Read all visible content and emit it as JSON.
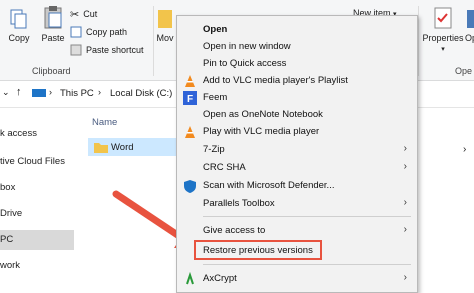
{
  "ribbon": {
    "copy": "Copy",
    "paste": "Paste",
    "cut": "Cut",
    "copy_path": "Copy path",
    "paste_shortcut": "Paste shortcut",
    "move_to": "Mov",
    "new_item": "New item",
    "properties": "Properties",
    "open_truncated": "Ope",
    "clipboard_group": "Clipboard",
    "open_group_truncated": "Ope"
  },
  "address": {
    "this_pc": "This PC",
    "local_disk": "Local Disk (C:)"
  },
  "nav": {
    "items": [
      "k access",
      "tive Cloud Files",
      "box",
      "Drive",
      "PC",
      "work"
    ]
  },
  "content": {
    "name_header": "Name",
    "folder_name": "Word"
  },
  "context_menu": {
    "items": [
      {
        "label": "Open",
        "bold": true
      },
      {
        "label": "Open in new window"
      },
      {
        "label": "Pin to Quick access"
      },
      {
        "label": "Add to VLC media player's Playlist",
        "icon": "vlc-cone-icon"
      },
      {
        "label": "Feem",
        "icon": "feem-icon"
      },
      {
        "label": "Open as OneNote Notebook"
      },
      {
        "label": "Play with VLC media player",
        "icon": "vlc-cone-icon"
      },
      {
        "label": "7-Zip",
        "submenu": true
      },
      {
        "label": "CRC SHA",
        "submenu": true
      },
      {
        "label": "Scan with Microsoft Defender...",
        "icon": "defender-shield-icon"
      },
      {
        "label": "Parallels Toolbox",
        "submenu": true
      },
      {
        "label": "Give access to",
        "submenu": true
      },
      {
        "label": "Restore previous versions"
      },
      {
        "label": "AxCrypt",
        "submenu": true,
        "icon": "axcrypt-icon"
      }
    ]
  },
  "colors": {
    "highlight_red": "#e8533f",
    "vlc_orange": "#f28a1e",
    "feem_blue": "#2f63d8",
    "defender_blue": "#1e74c7",
    "folder_yellow": "#f2c44b"
  }
}
